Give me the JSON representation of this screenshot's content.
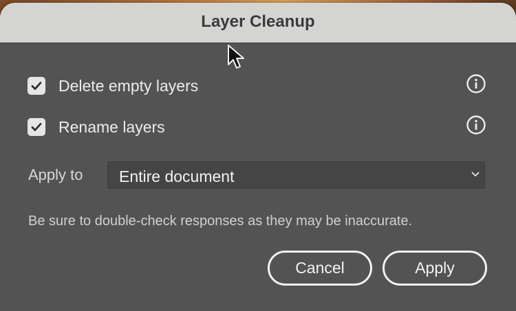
{
  "dialog": {
    "title": "Layer Cleanup"
  },
  "options": [
    {
      "label": "Delete empty layers",
      "checked": true,
      "info_icon": "info-icon"
    },
    {
      "label": "Rename layers",
      "checked": true,
      "info_icon": "info-icon"
    }
  ],
  "apply_to": {
    "label": "Apply to",
    "selected": "Entire document"
  },
  "disclaimer": "Be sure to double-check responses as they may be inaccurate.",
  "buttons": {
    "cancel": "Cancel",
    "apply": "Apply"
  },
  "colors": {
    "dialog_bg": "#535353",
    "titlebar_bg": "#d4d4d2",
    "text": "#ececec"
  }
}
